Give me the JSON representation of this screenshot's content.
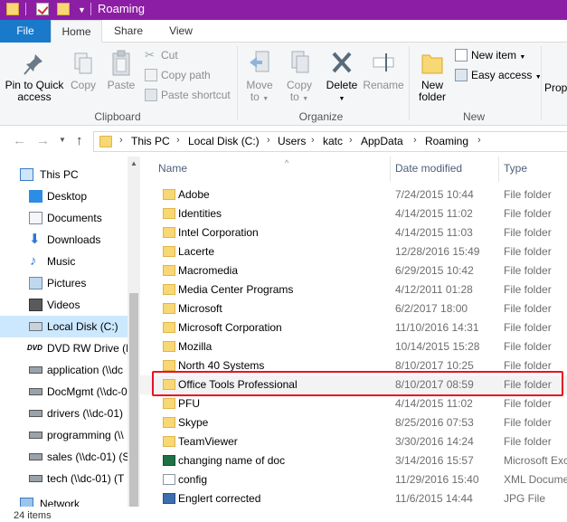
{
  "window": {
    "title": "Roaming"
  },
  "ribbon_tabs": {
    "file": "File",
    "home": "Home",
    "share": "Share",
    "view": "View"
  },
  "clipboard": {
    "pin_label_1": "Pin to Quick",
    "pin_label_2": "access",
    "copy": "Copy",
    "paste": "Paste",
    "cut": "Cut",
    "copy_path": "Copy path",
    "paste_shortcut": "Paste shortcut",
    "group": "Clipboard"
  },
  "organize": {
    "move_to_1": "Move",
    "move_to_2": "to",
    "copy_to_1": "Copy",
    "copy_to_2": "to",
    "delete": "Delete",
    "rename": "Rename",
    "group": "Organize"
  },
  "new_group": {
    "new_folder_1": "New",
    "new_folder_2": "folder",
    "new_item": "New item",
    "easy_access": "Easy access",
    "group": "New",
    "properties_partial": "Prop"
  },
  "address": {
    "crumbs": [
      "This PC",
      "Local Disk (C:)",
      "Users",
      "katc",
      "AppData",
      "Roaming"
    ]
  },
  "nav": {
    "items": [
      {
        "label": "This PC",
        "icon": "pc-icon"
      },
      {
        "label": "Desktop",
        "icon": "desktop-icon"
      },
      {
        "label": "Documents",
        "icon": "documents-icon"
      },
      {
        "label": "Downloads",
        "icon": "downloads-icon"
      },
      {
        "label": "Music",
        "icon": "music-icon"
      },
      {
        "label": "Pictures",
        "icon": "pictures-icon"
      },
      {
        "label": "Videos",
        "icon": "videos-icon"
      },
      {
        "label": "Local Disk (C:)",
        "icon": "disk-icon"
      },
      {
        "label": "DVD RW Drive (D",
        "icon": "dvd-icon"
      },
      {
        "label": "application (\\\\dc",
        "icon": "network-drive-icon"
      },
      {
        "label": "DocMgmt (\\\\dc-0",
        "icon": "network-drive-icon"
      },
      {
        "label": "drivers (\\\\dc-01)",
        "icon": "network-drive-icon"
      },
      {
        "label": "programming (\\\\",
        "icon": "network-drive-icon"
      },
      {
        "label": "sales (\\\\dc-01) (S",
        "icon": "network-drive-icon"
      },
      {
        "label": "tech (\\\\dc-01) (T",
        "icon": "network-drive-icon"
      },
      {
        "label": "Network",
        "icon": "network-icon"
      }
    ]
  },
  "columns": {
    "name": "Name",
    "date": "Date modified",
    "type": "Type"
  },
  "files": [
    {
      "name": "Adobe",
      "date": "7/24/2015 10:44",
      "type": "File folder",
      "icon": "folder-icon"
    },
    {
      "name": "Identities",
      "date": "4/14/2015 11:02",
      "type": "File folder",
      "icon": "folder-icon"
    },
    {
      "name": "Intel Corporation",
      "date": "4/14/2015 11:03",
      "type": "File folder",
      "icon": "folder-icon"
    },
    {
      "name": "Lacerte",
      "date": "12/28/2016 15:49",
      "type": "File folder",
      "icon": "folder-icon"
    },
    {
      "name": "Macromedia",
      "date": "6/29/2015 10:42",
      "type": "File folder",
      "icon": "folder-icon"
    },
    {
      "name": "Media Center Programs",
      "date": "4/12/2011 01:28",
      "type": "File folder",
      "icon": "folder-icon"
    },
    {
      "name": "Microsoft",
      "date": "6/2/2017 18:00",
      "type": "File folder",
      "icon": "folder-icon"
    },
    {
      "name": "Microsoft Corporation",
      "date": "11/10/2016 14:31",
      "type": "File folder",
      "icon": "folder-icon"
    },
    {
      "name": "Mozilla",
      "date": "10/14/2015 15:28",
      "type": "File folder",
      "icon": "folder-icon"
    },
    {
      "name": "North 40 Systems",
      "date": "8/10/2017 10:25",
      "type": "File folder",
      "icon": "folder-icon"
    },
    {
      "name": "Office Tools Professional",
      "date": "8/10/2017 08:59",
      "type": "File folder",
      "icon": "folder-icon"
    },
    {
      "name": "PFU",
      "date": "4/14/2015 11:02",
      "type": "File folder",
      "icon": "folder-icon"
    },
    {
      "name": "Skype",
      "date": "8/25/2016 07:53",
      "type": "File folder",
      "icon": "folder-icon"
    },
    {
      "name": "TeamViewer",
      "date": "3/30/2016 14:24",
      "type": "File folder",
      "icon": "folder-icon"
    },
    {
      "name": "changing name of doc",
      "date": "3/14/2016 15:57",
      "type": "Microsoft Exce",
      "icon": "excel-file-icon"
    },
    {
      "name": "config",
      "date": "11/29/2016 15:40",
      "type": "XML Docume",
      "icon": "xml-file-icon"
    },
    {
      "name": "Englert corrected",
      "date": "11/6/2015 14:44",
      "type": "JPG File",
      "icon": "jpg-file-icon"
    }
  ],
  "status": {
    "item_count": "24 items"
  },
  "colors": {
    "titlebar": "#8C1EA5",
    "file_tab": "#1979CA",
    "selection": "#CCE8FF",
    "highlight_box": "#E81123"
  }
}
